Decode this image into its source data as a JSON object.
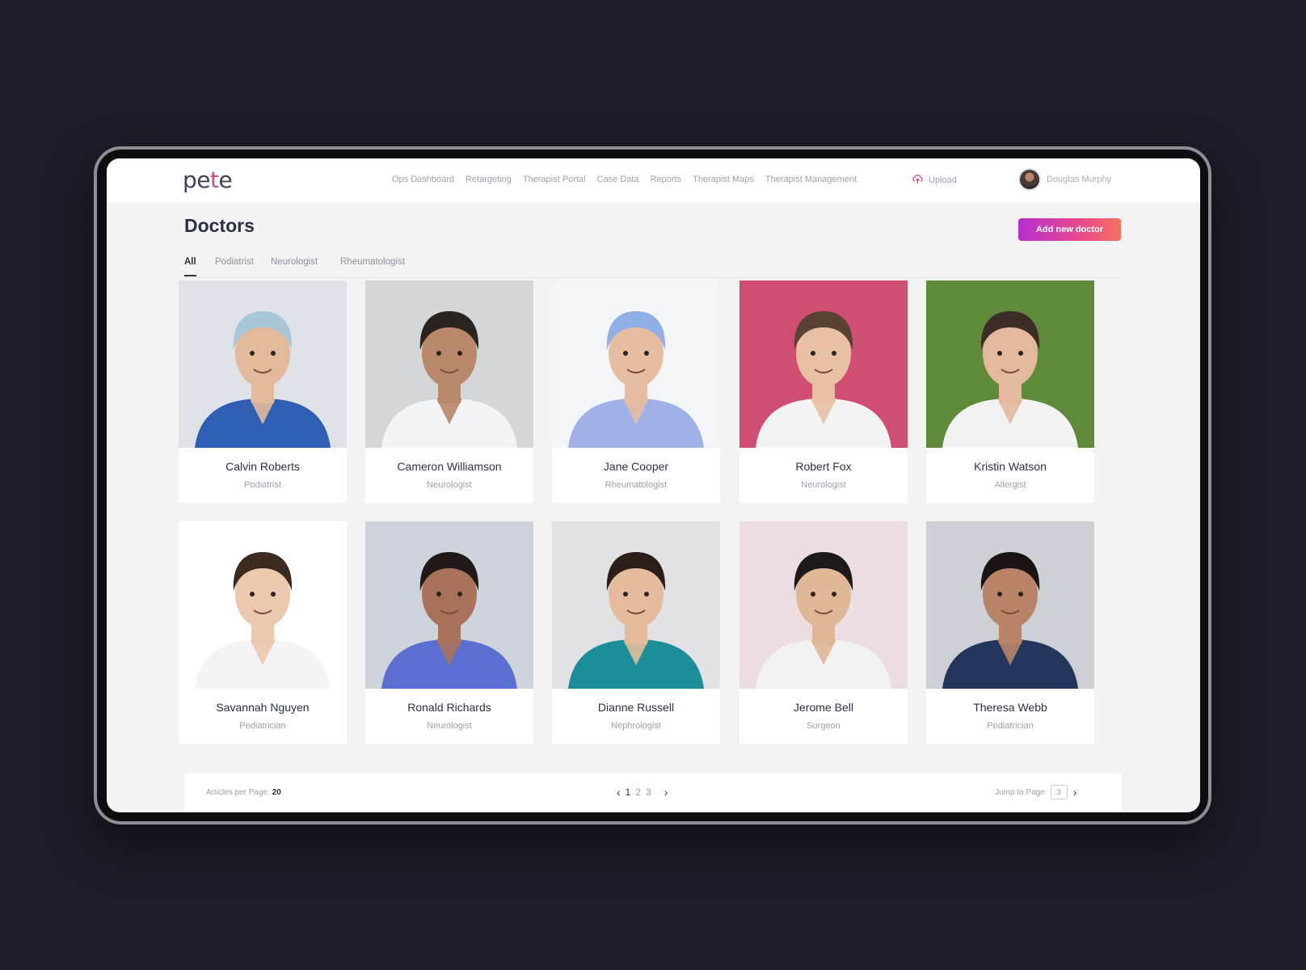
{
  "app": {
    "logo_pre": "pe",
    "logo_mid": "t",
    "logo_post": "e"
  },
  "nav": {
    "items": [
      "Ops Dashboard",
      "Retargeting",
      "Therapist Portal",
      "Case Data",
      "Reports",
      "Therapist Maps",
      "Therapist Management"
    ],
    "upload_label": "Upload",
    "user_name": "Douglas Murphy"
  },
  "page": {
    "title": "Doctors",
    "add_button": "Add new doctor"
  },
  "tabs": [
    "All",
    "Podiatrist",
    "Neurologist",
    "Rheumatologist"
  ],
  "active_tab": "All",
  "doctors": [
    {
      "name": "Calvin Roberts",
      "specialty": "Podiatrist",
      "bg": "#dfe3e8",
      "coat": "#2f5fb3",
      "skin": "#e3b99b",
      "hair": "#a8c7d8"
    },
    {
      "name": "Cameron Williamson",
      "specialty": "Neurologist",
      "bg": "#d4d6d8",
      "coat": "#f2f4f6",
      "skin": "#b9876a",
      "hair": "#2a2421"
    },
    {
      "name": "Jane Cooper",
      "specialty": "Rheumatologist",
      "bg": "#f4f5f7",
      "coat": "#9fb1e6",
      "skin": "#e6bda1",
      "hair": "#8fb0e6"
    },
    {
      "name": "Robert Fox",
      "specialty": "Neurologist",
      "bg": "#cf4e72",
      "coat": "#f3f3f3",
      "skin": "#e8c0a3",
      "hair": "#5a4232"
    },
    {
      "name": "Kristin Watson",
      "specialty": "Allergist",
      "bg": "#5f8a3a",
      "coat": "#f2f2f2",
      "skin": "#e2b99c",
      "hair": "#3c2e26"
    },
    {
      "name": "Savannah Nguyen",
      "specialty": "Pediatrician",
      "bg": "#ffffff",
      "coat": "#f4f4f4",
      "skin": "#ecc8ae",
      "hair": "#3a2a20"
    },
    {
      "name": "Ronald Richards",
      "specialty": "Neurologist",
      "bg": "#cfd3db",
      "coat": "#5a6fd0",
      "skin": "#a8735a",
      "hair": "#1f1a18"
    },
    {
      "name": "Dianne Russell",
      "specialty": "Nephrologist",
      "bg": "#e2e2e4",
      "coat": "#1b8e9a",
      "skin": "#e4bb9c",
      "hair": "#2b1d17"
    },
    {
      "name": "Jerome Bell",
      "specialty": "Surgeon",
      "bg": "#ebdde1",
      "coat": "#f2f2f2",
      "skin": "#e0b797",
      "hair": "#1c1a1a"
    },
    {
      "name": "Theresa Webb",
      "specialty": "Pediatrician",
      "bg": "#cdd0d4",
      "coat": "#25365c",
      "skin": "#b88366",
      "hair": "#1b1414"
    }
  ],
  "pagination": {
    "per_page_label": "Articles per Page:",
    "per_page_value": "20",
    "pages": [
      "1",
      "2",
      "3"
    ],
    "current_page": "1",
    "jump_label": "Jump to Page",
    "jump_value": "3"
  },
  "icons": {
    "upload": "upload-cloud-icon",
    "prev": "chevron-left-icon",
    "next": "chevron-right-icon"
  }
}
